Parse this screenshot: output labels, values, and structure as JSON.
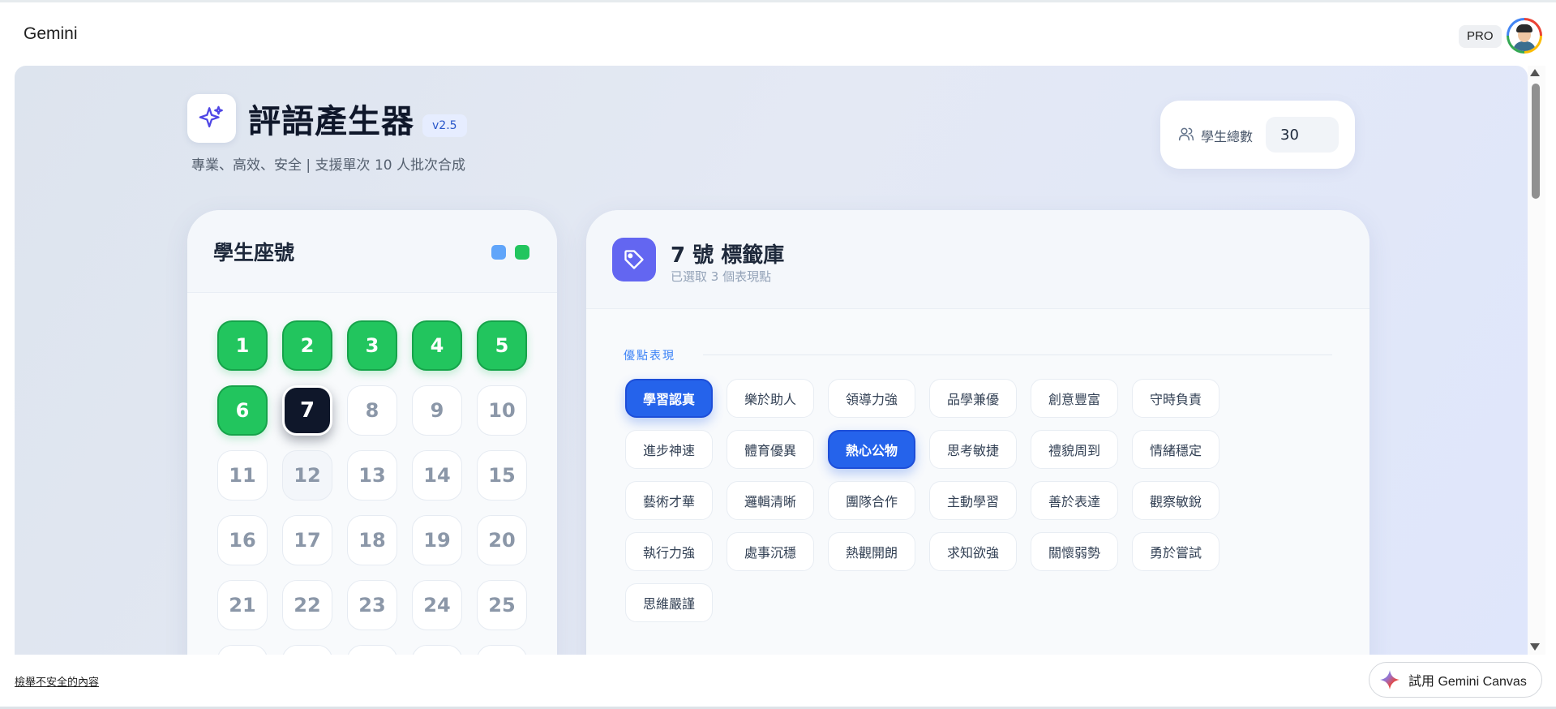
{
  "header": {
    "brand": "Gemini",
    "pro_badge": "PRO"
  },
  "app": {
    "title": "評語產生器",
    "version": "v2.5",
    "subtitle": "專業、高效、安全 | 支援單次 10 人批次合成",
    "student_count_label": "學生總數",
    "student_count_value": "30"
  },
  "seats": {
    "title": "學生座號",
    "items": [
      {
        "n": "1",
        "state": "done"
      },
      {
        "n": "2",
        "state": "done"
      },
      {
        "n": "3",
        "state": "done"
      },
      {
        "n": "4",
        "state": "done"
      },
      {
        "n": "5",
        "state": "done"
      },
      {
        "n": "6",
        "state": "done"
      },
      {
        "n": "7",
        "state": "current"
      },
      {
        "n": "8",
        "state": "empty"
      },
      {
        "n": "9",
        "state": "empty"
      },
      {
        "n": "10",
        "state": "empty"
      },
      {
        "n": "11",
        "state": "empty"
      },
      {
        "n": "12",
        "state": "shaded"
      },
      {
        "n": "13",
        "state": "empty"
      },
      {
        "n": "14",
        "state": "empty"
      },
      {
        "n": "15",
        "state": "empty"
      },
      {
        "n": "16",
        "state": "empty"
      },
      {
        "n": "17",
        "state": "empty"
      },
      {
        "n": "18",
        "state": "empty"
      },
      {
        "n": "19",
        "state": "empty"
      },
      {
        "n": "20",
        "state": "empty"
      },
      {
        "n": "21",
        "state": "empty"
      },
      {
        "n": "22",
        "state": "empty"
      },
      {
        "n": "23",
        "state": "empty"
      },
      {
        "n": "24",
        "state": "empty"
      },
      {
        "n": "25",
        "state": "empty"
      },
      {
        "n": "",
        "state": "empty"
      },
      {
        "n": "",
        "state": "empty"
      },
      {
        "n": "",
        "state": "empty"
      },
      {
        "n": "",
        "state": "empty"
      },
      {
        "n": "",
        "state": "empty"
      }
    ]
  },
  "tag_panel": {
    "title": "7 號 標籤庫",
    "subtitle": "已選取 3 個表現點",
    "section_label": "優點表現",
    "tags": [
      {
        "label": "學習認真",
        "selected": true
      },
      {
        "label": "樂於助人",
        "selected": false
      },
      {
        "label": "領導力強",
        "selected": false
      },
      {
        "label": "品學兼優",
        "selected": false
      },
      {
        "label": "創意豐富",
        "selected": false
      },
      {
        "label": "守時負責",
        "selected": false
      },
      {
        "label": "進步神速",
        "selected": false
      },
      {
        "label": "體育優異",
        "selected": false
      },
      {
        "label": "熱心公物",
        "selected": true
      },
      {
        "label": "思考敏捷",
        "selected": false
      },
      {
        "label": "禮貌周到",
        "selected": false
      },
      {
        "label": "情緒穩定",
        "selected": false
      },
      {
        "label": "藝術才華",
        "selected": false
      },
      {
        "label": "邏輯清晰",
        "selected": false
      },
      {
        "label": "團隊合作",
        "selected": false
      },
      {
        "label": "主動學習",
        "selected": false
      },
      {
        "label": "善於表達",
        "selected": false
      },
      {
        "label": "觀察敏銳",
        "selected": false
      },
      {
        "label": "執行力強",
        "selected": false
      },
      {
        "label": "處事沉穩",
        "selected": false
      },
      {
        "label": "熱觀開朗",
        "selected": false
      },
      {
        "label": "求知欲強",
        "selected": false
      },
      {
        "label": "關懷弱勢",
        "selected": false
      },
      {
        "label": "勇於嘗試",
        "selected": false
      },
      {
        "label": "思維嚴謹",
        "selected": false
      }
    ]
  },
  "footer": {
    "report_link": "檢舉不安全的內容",
    "canvas_button": "試用 Gemini Canvas"
  },
  "colors": {
    "accent_blue": "#2563eb",
    "done_green": "#22c55e",
    "current_dark": "#0f172a",
    "tag_icon_purple": "#6366f1"
  },
  "icons": {
    "app_icon": "sparkle-icon",
    "count_icon": "users-icon",
    "tag_icon": "tag-icon",
    "canvas_icon": "gemini-spark-icon"
  }
}
